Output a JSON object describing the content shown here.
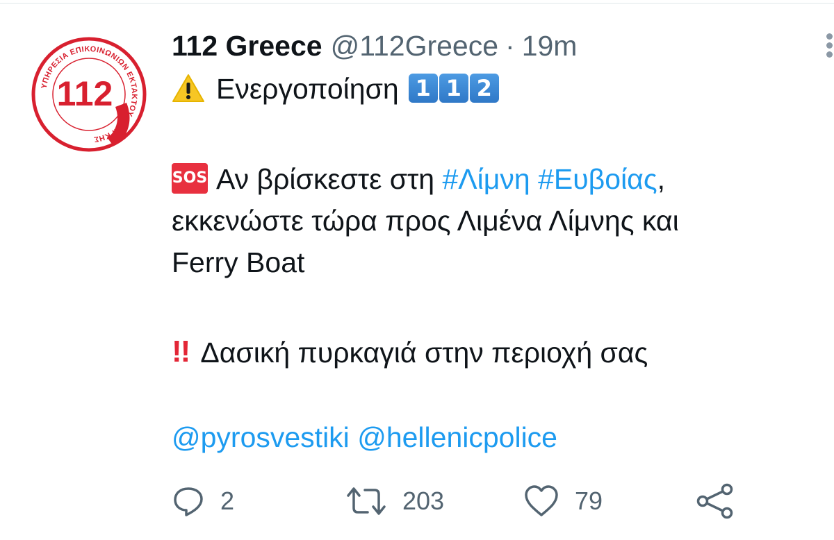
{
  "author": {
    "name": "112 Greece",
    "handle": "@112Greece",
    "separator": "·",
    "time": "19m",
    "avatar_number": "112",
    "avatar_ring_text": "ΥΠΗΡΕΣΙΑ ΕΠΙΚΟΙΝΩΝΙΩΝ ΕΚΤΑΚΤΟΥ ΑΝΑΓΚΗΣ"
  },
  "tweet": {
    "line1": {
      "emoji": "warning-icon",
      "text": "Ενεργοποίηση",
      "keycaps": [
        "1",
        "1",
        "2"
      ]
    },
    "line2": {
      "emoji_label": "SOS",
      "text_before": "Αν βρίσκεστε στη ",
      "hashtag1": "#Λίμνη",
      "space": " ",
      "hashtag2": "#Ευβοίας",
      "text_after": ","
    },
    "line3": "εκκενώστε τώρα προς Λιμένα Λίμνης και",
    "line4": "Ferry Boat",
    "line5": {
      "emoji": "double-exclamation-icon",
      "emoji_glyph": "!!",
      "text": "Δασική πυρκαγιά στην περιοχή σας"
    },
    "line6": {
      "mention1": "@pyrosvestiki",
      "space": " ",
      "mention2": "@hellenicpolice"
    }
  },
  "actions": {
    "reply": {
      "icon": "reply-icon",
      "count": "2"
    },
    "retweet": {
      "icon": "retweet-icon",
      "count": "203"
    },
    "like": {
      "icon": "heart-icon",
      "count": "79"
    },
    "share": {
      "icon": "share-icon"
    }
  },
  "colors": {
    "link": "#1d9bf0",
    "secondary_text": "#536471",
    "brand_red": "#d8202f"
  }
}
